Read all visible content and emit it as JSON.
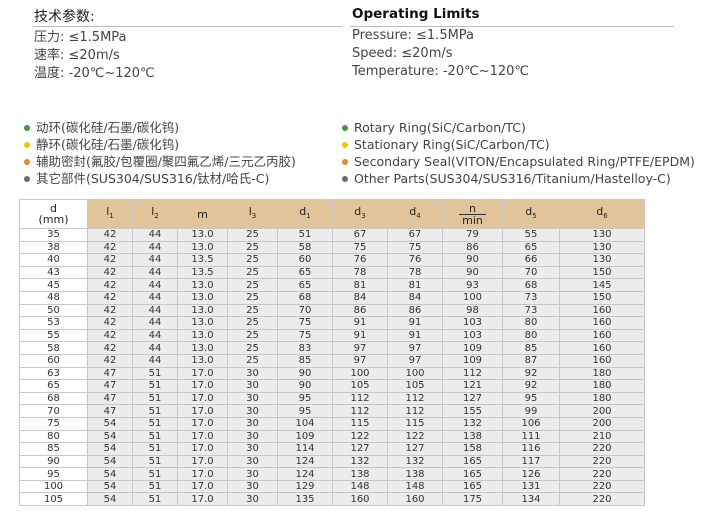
{
  "headings": {
    "cn": "技术参数:",
    "en": "Operating Limits"
  },
  "specs_cn": [
    "压力:  ≤1.5MPa",
    "速率:  ≤20m/s",
    "温度:  -20℃~120℃"
  ],
  "specs_en": [
    "Pressure:  ≤1.5MPa",
    "Speed:  ≤20m/s",
    "Temperature: -20℃~120℃"
  ],
  "materials_cn": [
    "动环(碳化硅/石墨/碳化钨)",
    "静环(碳化硅/石墨/碳化钨)",
    "辅助密封(氟胶/包覆圈/聚四氟乙烯/三元乙丙胶)",
    "其它部件(SUS304/SUS316/钛材/哈氏-C)"
  ],
  "materials_en": [
    "Rotary  Ring(SiC/Carbon/TC)",
    "Stationary  Ring(SiC/Carbon/TC)",
    "Secondary Seal(VITON/Encapsulated Ring/PTFE/EPDM)",
    "Other Parts(SUS304/SUS316/Titanium/Hastelloy-C)"
  ],
  "colors": {
    "green": "#3d9a3d",
    "yellow": "#f2c500",
    "orange": "#e08a2a",
    "gray": "#6b6b6b",
    "header_bg": "#e2c49a",
    "row_bg": "#ececec"
  },
  "table": {
    "headers": {
      "d_top": "d",
      "d_bottom": "(mm)",
      "l1": "l",
      "l1_sub": "1",
      "l2": "l",
      "l2_sub": "2",
      "m": "m",
      "l3": "l",
      "l3_sub": "3",
      "d1": "d",
      "d1_sub": "1",
      "d3": "d",
      "d3_sub": "3",
      "d4": "d",
      "d4_sub": "4",
      "n_num": "n",
      "n_den": "min",
      "d5": "d",
      "d5_sub": "5",
      "d6": "d",
      "d6_sub": "6"
    },
    "rows": [
      [
        "35",
        "42",
        "44",
        "13.0",
        "25",
        "51",
        "67",
        "67",
        "79",
        "55",
        "130"
      ],
      [
        "38",
        "42",
        "44",
        "13.0",
        "25",
        "58",
        "75",
        "75",
        "86",
        "65",
        "130"
      ],
      [
        "40",
        "42",
        "44",
        "13.5",
        "25",
        "60",
        "76",
        "76",
        "90",
        "66",
        "130"
      ],
      [
        "43",
        "42",
        "44",
        "13.5",
        "25",
        "65",
        "78",
        "78",
        "90",
        "70",
        "150"
      ],
      [
        "45",
        "42",
        "44",
        "13.0",
        "25",
        "65",
        "81",
        "81",
        "93",
        "68",
        "145"
      ],
      [
        "48",
        "42",
        "44",
        "13.0",
        "25",
        "68",
        "84",
        "84",
        "100",
        "73",
        "150"
      ],
      [
        "50",
        "42",
        "44",
        "13.0",
        "25",
        "70",
        "86",
        "86",
        "98",
        "73",
        "160"
      ],
      [
        "53",
        "42",
        "44",
        "13.0",
        "25",
        "75",
        "91",
        "91",
        "103",
        "80",
        "160"
      ],
      [
        "55",
        "42",
        "44",
        "13.0",
        "25",
        "75",
        "91",
        "91",
        "103",
        "80",
        "160"
      ],
      [
        "58",
        "42",
        "44",
        "13.0",
        "25",
        "83",
        "97",
        "97",
        "109",
        "85",
        "160"
      ],
      [
        "60",
        "42",
        "44",
        "13.0",
        "25",
        "85",
        "97",
        "97",
        "109",
        "87",
        "160"
      ],
      [
        "63",
        "47",
        "51",
        "17.0",
        "30",
        "90",
        "100",
        "100",
        "112",
        "92",
        "180"
      ],
      [
        "65",
        "47",
        "51",
        "17.0",
        "30",
        "90",
        "105",
        "105",
        "121",
        "92",
        "180"
      ],
      [
        "68",
        "47",
        "51",
        "17.0",
        "30",
        "95",
        "112",
        "112",
        "127",
        "95",
        "180"
      ],
      [
        "70",
        "47",
        "51",
        "17.0",
        "30",
        "95",
        "112",
        "112",
        "155",
        "99",
        "200"
      ],
      [
        "75",
        "54",
        "51",
        "17.0",
        "30",
        "104",
        "115",
        "115",
        "132",
        "106",
        "200"
      ],
      [
        "80",
        "54",
        "51",
        "17.0",
        "30",
        "109",
        "122",
        "122",
        "138",
        "111",
        "210"
      ],
      [
        "85",
        "54",
        "51",
        "17.0",
        "30",
        "114",
        "127",
        "127",
        "158",
        "116",
        "220"
      ],
      [
        "90",
        "54",
        "51",
        "17.0",
        "30",
        "124",
        "132",
        "132",
        "165",
        "117",
        "220"
      ],
      [
        "95",
        "54",
        "51",
        "17.0",
        "30",
        "124",
        "138",
        "138",
        "165",
        "126",
        "220"
      ],
      [
        "100",
        "54",
        "51",
        "17.0",
        "30",
        "129",
        "148",
        "148",
        "165",
        "131",
        "220"
      ],
      [
        "105",
        "54",
        "51",
        "17.0",
        "30",
        "135",
        "160",
        "160",
        "175",
        "134",
        "220"
      ]
    ]
  }
}
